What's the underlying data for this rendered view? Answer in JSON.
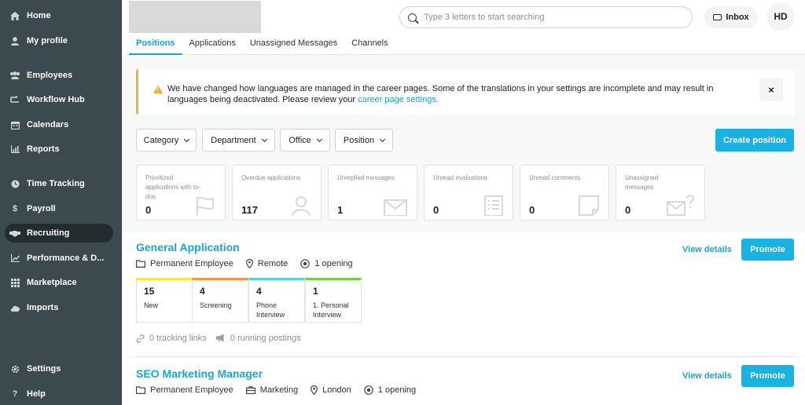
{
  "sidebar": {
    "items": [
      {
        "label": "Home",
        "icon": "home-icon"
      },
      {
        "label": "My profile",
        "icon": "user-icon"
      },
      {
        "label": "Employees",
        "icon": "people-icon"
      },
      {
        "label": "Workflow Hub",
        "icon": "workflow-icon"
      },
      {
        "label": "Calendars",
        "icon": "calendar-icon"
      },
      {
        "label": "Reports",
        "icon": "chart-icon"
      },
      {
        "label": "Time Tracking",
        "icon": "clock-icon"
      },
      {
        "label": "Payroll",
        "icon": "dollar-icon"
      },
      {
        "label": "Recruiting",
        "icon": "handshake-icon",
        "active": true
      },
      {
        "label": "Performance & D...",
        "icon": "performance-icon"
      },
      {
        "label": "Marketplace",
        "icon": "grid-icon"
      },
      {
        "label": "Imports",
        "icon": "cloud-icon"
      },
      {
        "label": "Settings",
        "icon": "gear-icon"
      },
      {
        "label": "Help",
        "icon": "question-icon"
      }
    ]
  },
  "header": {
    "search_placeholder": "Type 3 letters to start searching",
    "inbox_label": "Inbox",
    "avatar_initials": "HD"
  },
  "tabs": [
    {
      "label": "Positions",
      "active": true
    },
    {
      "label": "Applications"
    },
    {
      "label": "Unassigned Messages"
    },
    {
      "label": "Channels"
    }
  ],
  "alert": {
    "text": "We have changed how languages are managed in the career pages. Some of the translations in your settings are incomplete and may result in languages being deactivated. Please review your ",
    "link": "career page settings.",
    "close": "×"
  },
  "filters": [
    "Category",
    "Department",
    "Office",
    "Position"
  ],
  "create_position_label": "Create position",
  "stats": [
    {
      "label": "Prioritized applications with to-dos",
      "value": "0",
      "icon": "flag-icon"
    },
    {
      "label": "Overdue applications",
      "value": "117",
      "icon": "person-icon"
    },
    {
      "label": "Unreplied messages",
      "value": "1",
      "icon": "envelope-icon"
    },
    {
      "label": "Unread evaluations",
      "value": "0",
      "icon": "checklist-icon"
    },
    {
      "label": "Unread comments",
      "value": "0",
      "icon": "comment-icon"
    },
    {
      "label": "Unassigned messages",
      "value": "0",
      "icon": "envelope-question-icon"
    }
  ],
  "positions": [
    {
      "title": "General Application",
      "view_details": "View details",
      "promote": "Promote",
      "employment": "Permanent Employee",
      "location": "Remote",
      "openings": "1 opening",
      "stages": [
        {
          "count": "15",
          "label": "New",
          "color": "#f5e63b"
        },
        {
          "count": "4",
          "label": "Screening",
          "color": "#f29a3d"
        },
        {
          "count": "4",
          "label": "Phone Interview",
          "color": "#4fd2f0"
        },
        {
          "count": "1",
          "label": "1. Personal Interview",
          "color": "#6cd23f"
        }
      ],
      "tracking_links": "0 tracking links",
      "running_postings": "0 running postings"
    },
    {
      "title": "SEO Marketing Manager",
      "view_details": "View details",
      "promote": "Promote",
      "employment": "Permanent Employee",
      "department": "Marketing",
      "location": "London",
      "openings": "1 opening"
    }
  ]
}
